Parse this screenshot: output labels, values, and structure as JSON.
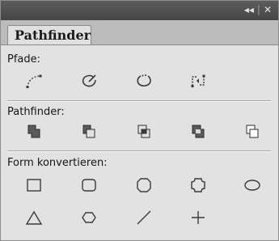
{
  "window": {
    "controls": {
      "collapse": "◂◂",
      "close": "✕"
    }
  },
  "tabs": [
    {
      "label": "Pathfinder",
      "active": true
    }
  ],
  "sections": {
    "pfade": {
      "label": "Pfade:",
      "buttons": [
        "join-icon",
        "close-path-icon",
        "open-path-icon",
        "reverse-path-icon"
      ]
    },
    "pathfinder": {
      "label": "Pathfinder:",
      "buttons": [
        "unite-icon",
        "minus-front-icon",
        "intersect-icon",
        "exclude-overlap-icon",
        "divide-icon"
      ]
    },
    "form": {
      "label": "Form konvertieren:",
      "buttons": [
        "rectangle-icon",
        "rounded-rectangle-icon",
        "beveled-rectangle-icon",
        "inverse-rounded-rectangle-icon",
        "ellipse-icon",
        "triangle-icon",
        "polygon-icon",
        "line-icon",
        "cross-icon"
      ]
    }
  },
  "colors": {
    "titlebar": "#4f4f4f",
    "panel": "#e2e2e2",
    "icon_dark": "#3a3a3a",
    "icon_fill": "#5a5a5a"
  }
}
